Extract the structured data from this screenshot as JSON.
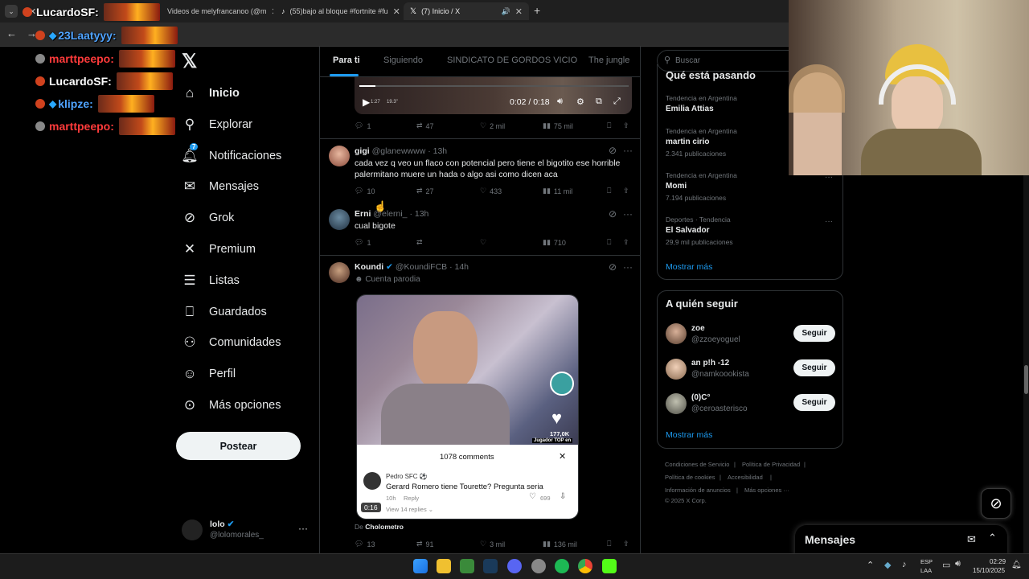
{
  "browser": {
    "tabs": [
      {
        "title": "LucardoSF:"
      },
      {
        "title": "Videos de melyfrancanoo (@m"
      },
      {
        "title": "(55)bajo al bloque #fortnite #fu"
      },
      {
        "title": "(7) Inicio / X"
      }
    ],
    "new_tab": "+"
  },
  "chat": {
    "lines": [
      {
        "user": "23Laatyyy:",
        "color": "#4fa3ff"
      },
      {
        "user": "marttpeepo:",
        "color": "#ff3b3b"
      },
      {
        "user": "LucardoSF:",
        "color": "#ffffff"
      },
      {
        "user": "klipze:",
        "color": "#4fa3ff"
      },
      {
        "user": "marttpeepo:",
        "color": "#ff3b3b"
      }
    ]
  },
  "nav": {
    "items": [
      {
        "label": "Inicio",
        "icon": "home-icon"
      },
      {
        "label": "Explorar",
        "icon": "search-icon"
      },
      {
        "label": "Notificaciones",
        "icon": "bell-icon",
        "badge": "7"
      },
      {
        "label": "Mensajes",
        "icon": "mail-icon"
      },
      {
        "label": "Grok",
        "icon": "grok-icon"
      },
      {
        "label": "Premium",
        "icon": "x-logo-icon"
      },
      {
        "label": "Listas",
        "icon": "list-icon"
      },
      {
        "label": "Guardados",
        "icon": "bookmark-icon"
      },
      {
        "label": "Comunidades",
        "icon": "people-icon"
      },
      {
        "label": "Perfil",
        "icon": "person-icon"
      },
      {
        "label": "Más opciones",
        "icon": "more-circle-icon"
      }
    ],
    "post_button": "Postear",
    "account": {
      "name": "lolo",
      "handle": "@lolomorales_"
    }
  },
  "timeline": {
    "tabs": [
      "Para ti",
      "Siguiendo",
      "SINDICATO DE GORDOS VICIO",
      "The jungle"
    ],
    "video": {
      "time": "0:02 / 0:18",
      "left_label": "1:27",
      "right_label": "19.3\""
    },
    "tweet0_actions": {
      "replies": "1",
      "retweets": "47",
      "likes": "2 mil",
      "views": "75 mil"
    },
    "tweets": [
      {
        "name": "gigi",
        "handle": "@glanewwww",
        "time": "· 13h",
        "text": "cada vez q veo un flaco con potencial pero tiene el bigotito ese horrible palermitano muere un hada o algo asi como dicen aca",
        "replies": "10",
        "retweets": "27",
        "likes": "433",
        "views": "11 mil"
      },
      {
        "name": "Erni",
        "handle": "@elerni_",
        "time": "· 13h",
        "text": "cual bigote",
        "replies": "1",
        "retweets": "",
        "likes": "",
        "views": "710"
      },
      {
        "name": "Koundi",
        "handle": "@KoundiFCB",
        "time": "· 14h",
        "label": "Cuenta parodia",
        "replies": "13",
        "retweets": "91",
        "likes": "3 mil",
        "views": "136 mil"
      }
    ],
    "embed": {
      "likes": "177,0K",
      "caption": "Jugador TOP en",
      "comments_title": "1078 comments",
      "commenter": "Pedro SFC ⚽",
      "comment": "Gerard Romero tiene Tourette? Pregunta seria",
      "comment_time": "10h",
      "reply": "Reply",
      "comment_likes": "699",
      "view_replies": "View 14 replies ⌄",
      "timestamp": "0:16",
      "credit_prefix": "De",
      "credit_name": "Cholometro"
    }
  },
  "right": {
    "search_placeholder": "Buscar",
    "trending_title": "Qué está pasando",
    "trends": [
      {
        "meta": "Tendencia en Argentina",
        "name": "Emilia Attias",
        "count": ""
      },
      {
        "meta": "Tendencia en Argentina",
        "name": "martin cirio",
        "count": "2.341 publicaciones"
      },
      {
        "meta": "Tendencia en Argentina",
        "name": "Momi",
        "count": "7.194 publicaciones"
      },
      {
        "meta": "Deportes · Tendencia",
        "name": "El Salvador",
        "count": "29,9 mil publicaciones"
      }
    ],
    "show_more": "Mostrar más",
    "follow_title": "A quién seguir",
    "follow": [
      {
        "name": "zoe",
        "handle": "@zzoeyoguel"
      },
      {
        "name": "an p!h -12",
        "handle": "@namkoookista"
      },
      {
        "name": "(0)C°",
        "handle": "@ceroasterisco"
      }
    ],
    "follow_button": "Seguir",
    "show_more2": "Mostrar más",
    "footer": [
      "Condiciones de Servicio",
      "Política de Privacidad",
      "Política de cookies",
      "Accesibilidad",
      "Información de anuncios",
      "Más opciones ···",
      "© 2025 X Corp."
    ],
    "messages_title": "Mensajes"
  },
  "taskbar": {
    "lang": "ESP",
    "lang2": "LAA",
    "time": "02:29",
    "date": "15/10/2025"
  }
}
